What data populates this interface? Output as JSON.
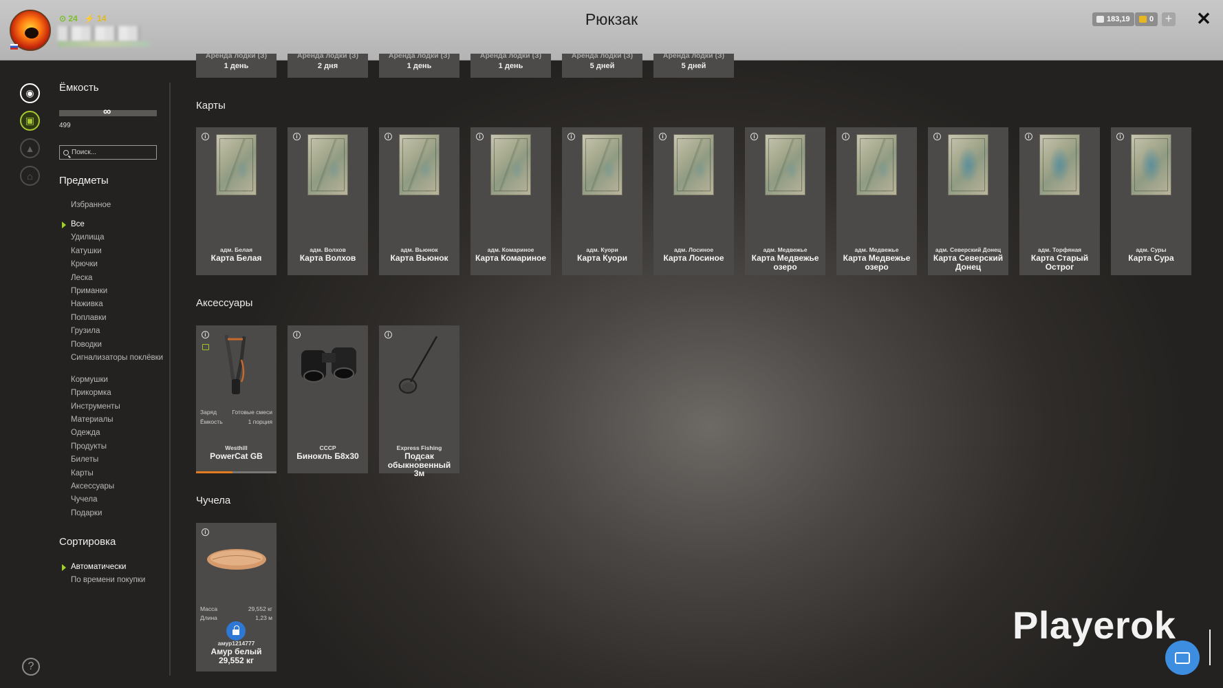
{
  "header": {
    "title": "Рюкзак",
    "stat_green": "24",
    "stat_yellow": "14",
    "currency_silver": "183,19",
    "currency_gold": "0",
    "add_label": "+",
    "close_label": "✕"
  },
  "sidebar": {
    "capacity_title": "Ёмкость",
    "capacity_symbol": "∞",
    "capacity_count": "499",
    "search_placeholder": "Поиск...",
    "items_title": "Предметы",
    "favorites": "Избранное",
    "filters": [
      "Все",
      "Удилища",
      "Катушки",
      "Крючки",
      "Леска",
      "Приманки",
      "Наживка",
      "Поплавки",
      "Грузила",
      "Поводки",
      "Сигнализаторы поклёвки",
      "Кормушки",
      "Прикормка",
      "Инструменты",
      "Материалы",
      "Одежда",
      "Продукты",
      "Билеты",
      "Карты",
      "Аксессуары",
      "Чучела",
      "Подарки"
    ],
    "active_filter": "Все",
    "sort_title": "Сортировка",
    "sort_options": [
      "Автоматически",
      "По времени покупки"
    ],
    "active_sort": "Автоматически",
    "help_label": "?"
  },
  "top_strip": [
    {
      "cut": "Аренда лодки (З)",
      "duration": "1 день"
    },
    {
      "cut": "Аренда лодки (З)",
      "duration": "2 дня"
    },
    {
      "cut": "Аренда лодки (З)",
      "duration": "1 день"
    },
    {
      "cut": "Аренда лодки (З)",
      "duration": "1 день"
    },
    {
      "cut": "Аренда лодки (З)",
      "duration": "5 дней"
    },
    {
      "cut": "Аренда лодки (З)",
      "duration": "5 дней"
    }
  ],
  "maps": {
    "title": "Карты",
    "items": [
      {
        "brand": "адм. Белая",
        "name": "Карта Белая"
      },
      {
        "brand": "адм. Волхов",
        "name": "Карта Волхов"
      },
      {
        "brand": "адм. Вьюнок",
        "name": "Карта Вьюнок"
      },
      {
        "brand": "адм. Комариное",
        "name": "Карта Комариное"
      },
      {
        "brand": "адм. Куори",
        "name": "Карта Куори"
      },
      {
        "brand": "адм. Лосиное",
        "name": "Карта Лосиное"
      },
      {
        "brand": "адм. Медвежье",
        "name": "Карта Медвежье озеро"
      },
      {
        "brand": "адм. Медвежье",
        "name": "Карта Медвежье озеро"
      },
      {
        "brand": "адм. Северский Донец",
        "name": "Карта Северский Донец"
      },
      {
        "brand": "адм. Торфяная",
        "name": "Карта Старый Острог"
      },
      {
        "brand": "адм. Суры",
        "name": "Карта Сура"
      }
    ]
  },
  "accessories": {
    "title": "Аксессуары",
    "items": [
      {
        "brand": "Westhill",
        "name": "PowerCat GB",
        "props": [
          [
            "Заряд",
            "Готовые смеси"
          ],
          [
            "Ёмкость",
            "1 порция"
          ]
        ],
        "progress": 0.45
      },
      {
        "brand": "СССР",
        "name": "Бинокль Б8х30"
      },
      {
        "brand": "Express Fishing",
        "name": "Подсак обыкновенный 3м"
      }
    ]
  },
  "trophies": {
    "title": "Чучела",
    "items": [
      {
        "owner": "амур1214777",
        "name": "Амур белый",
        "weight": "29,552 кг",
        "props": [
          [
            "Масса",
            "29,552 кг"
          ],
          [
            "Длина",
            "1,23 м"
          ]
        ]
      }
    ]
  },
  "watermark": "Playerok",
  "colors": {
    "accent_green": "#9fd12a",
    "progress_orange": "#e37b1e",
    "lock_blue": "#2e78d4"
  }
}
